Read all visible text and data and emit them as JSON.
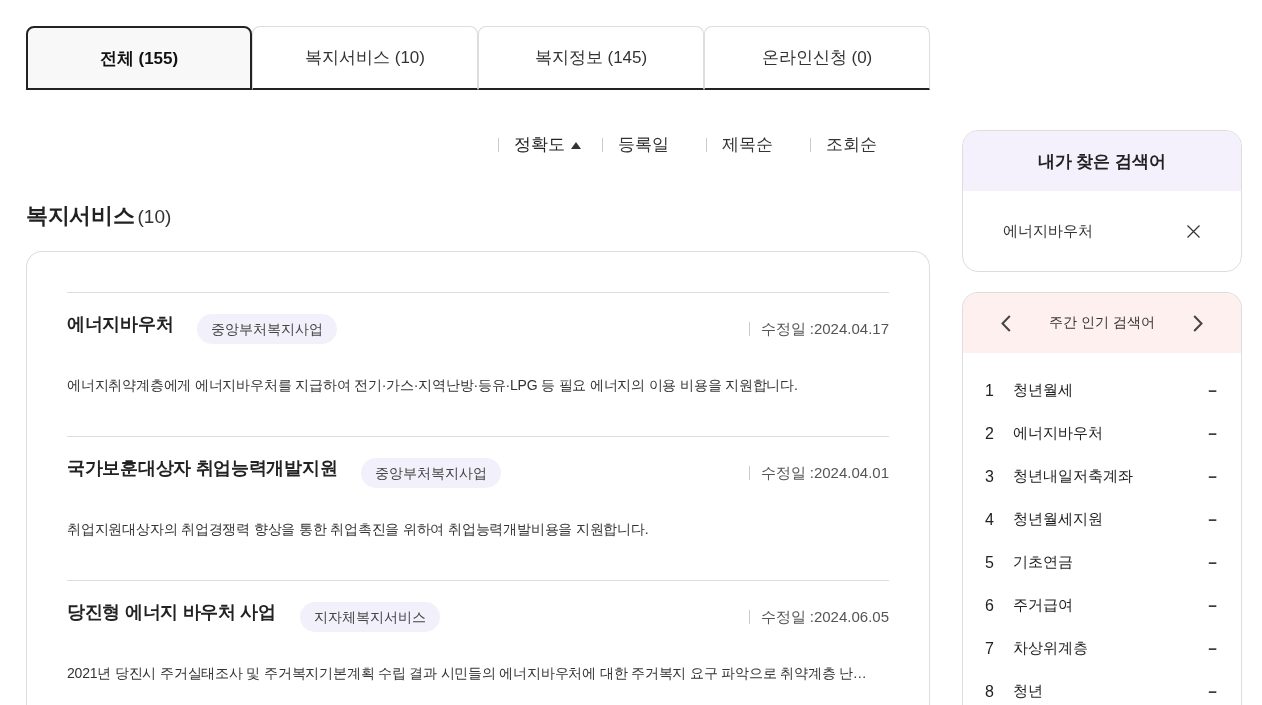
{
  "tabs": [
    {
      "label": "전체 (155)",
      "selected": true
    },
    {
      "label": "복지서비스 (10)",
      "selected": false
    },
    {
      "label": "복지정보 (145)",
      "selected": false
    },
    {
      "label": "온라인신청 (0)",
      "selected": false
    }
  ],
  "sort_options": [
    {
      "label": "정확도",
      "selected": true
    },
    {
      "label": "등록일",
      "selected": false
    },
    {
      "label": "제목순",
      "selected": false
    },
    {
      "label": "조회순",
      "selected": false
    }
  ],
  "section": {
    "title": "복지서비스",
    "count": "(10)",
    "results": [
      {
        "title": "에너지바우처",
        "tag": "중앙부처복지사업",
        "modified": "수정일 :2024.04.17",
        "description": "에너지취약계층에게 에너지바우처를 지급하여 전기·가스·지역난방·등유·LPG 등 필요 에너지의 이용 비용을 지원합니다."
      },
      {
        "title": "국가보훈대상자 취업능력개발지원",
        "tag": "중앙부처복지사업",
        "modified": "수정일 :2024.04.01",
        "description": "취업지원대상자의 취업경쟁력 향상을 통한 취업촉진을 위하여 취업능력개발비용을 지원합니다."
      },
      {
        "title": "당진형 에너지 바우처 사업",
        "tag": "지자체복지서비스",
        "modified": "수정일 :2024.06.05",
        "description": "2021년 당진시 주거실태조사 및 주거복지기본계획 수립 결과 시민들의 에너지바우처에 대한 주거복지 요구 파악으로 취약계층 난…"
      }
    ]
  },
  "recent_searches": {
    "title": "내가 찾은 검색어",
    "terms": [
      "에너지바우처"
    ]
  },
  "popular_searches": {
    "title": "주간 인기 검색어",
    "items": [
      {
        "rank": "1",
        "term": "청년월세",
        "change": "−"
      },
      {
        "rank": "2",
        "term": "에너지바우처",
        "change": "−"
      },
      {
        "rank": "3",
        "term": "청년내일저축계좌",
        "change": "−"
      },
      {
        "rank": "4",
        "term": "청년월세지원",
        "change": "−"
      },
      {
        "rank": "5",
        "term": "기초연금",
        "change": "−"
      },
      {
        "rank": "6",
        "term": "주거급여",
        "change": "−"
      },
      {
        "rank": "7",
        "term": "차상위계층",
        "change": "−"
      },
      {
        "rank": "8",
        "term": "청년",
        "change": "−"
      }
    ]
  }
}
